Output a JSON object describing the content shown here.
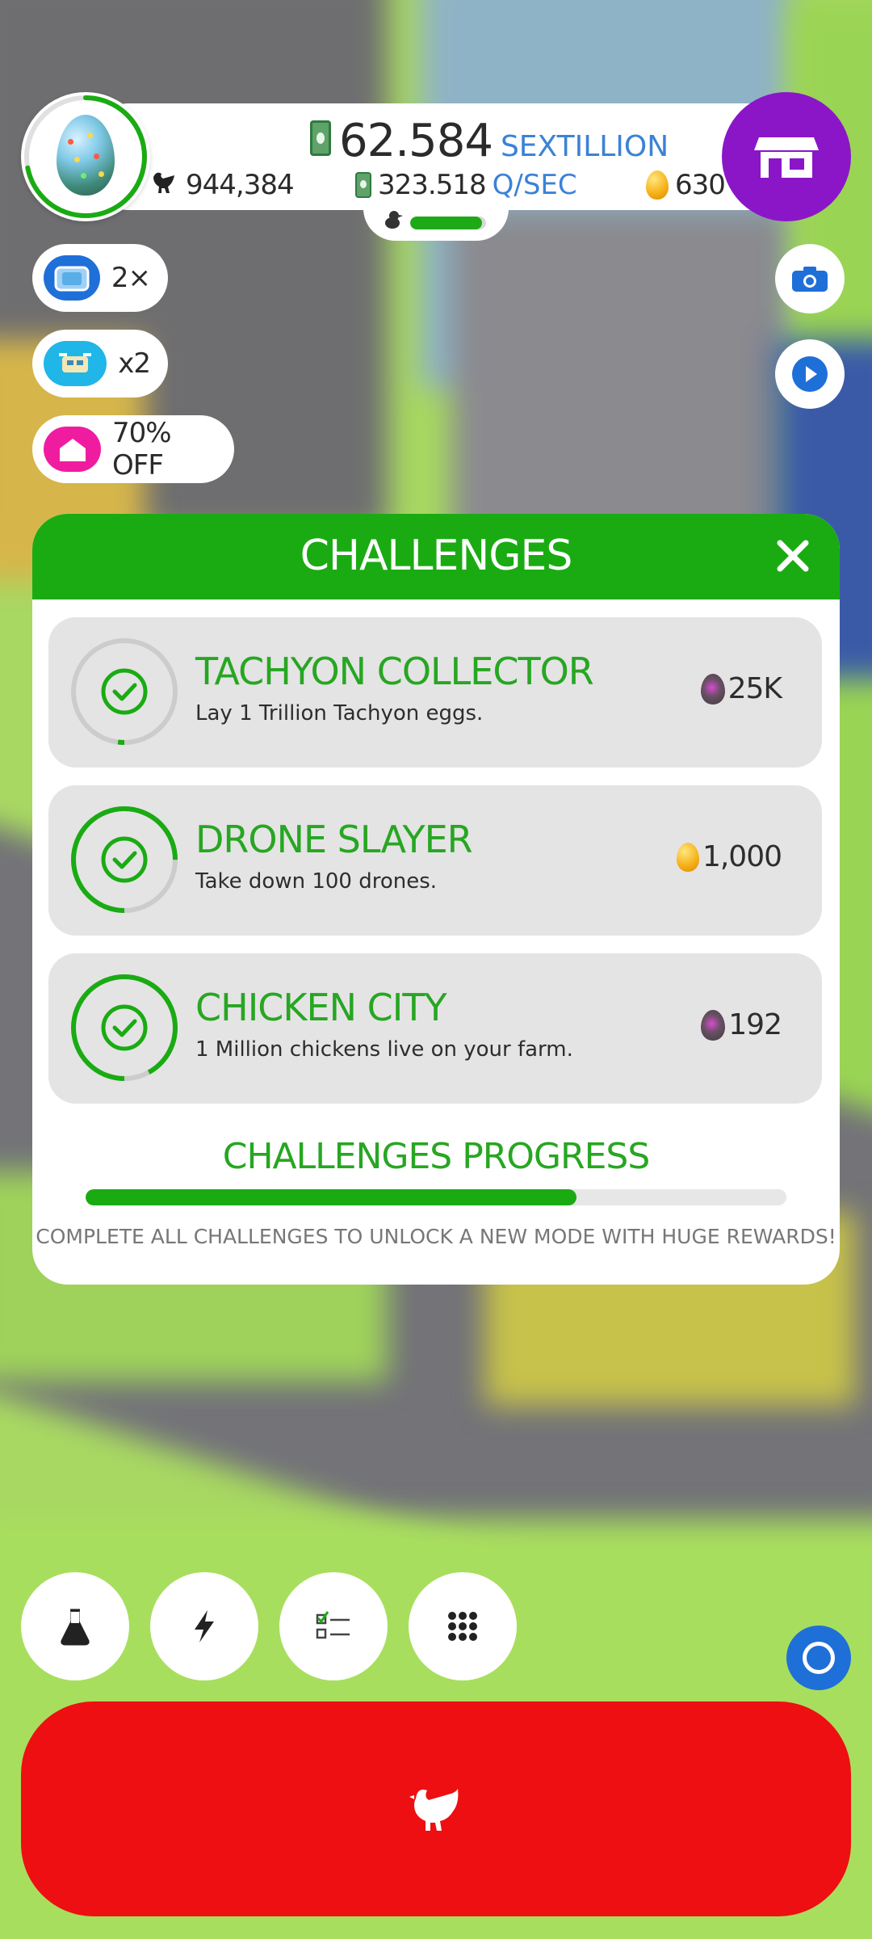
{
  "hud": {
    "cash_value": "62.584",
    "cash_unit": "SEXTILLION",
    "chicken_count": "944,384",
    "rate_value": "323.518",
    "rate_unit": "Q/SEC",
    "golden_eggs": "630",
    "hab_capacity_fill": 0.95
  },
  "boosts": [
    {
      "label": "2×",
      "icon": "tv-icon",
      "color": "#1f6fd8"
    },
    {
      "label": "x2",
      "icon": "drone-icon",
      "color": "#21b6e8"
    },
    {
      "label": "70% OFF",
      "icon": "shop-house-icon",
      "color": "#f01ca0"
    }
  ],
  "challenges_modal": {
    "title": "CHALLENGES",
    "items": [
      {
        "name": "TACHYON COLLECTOR",
        "description": "Lay 1 Trillion Tachyon eggs.",
        "reward": "25K",
        "reward_icon": "dark-egg-icon",
        "progress": 0.02
      },
      {
        "name": "DRONE SLAYER",
        "description": "Take down 100 drones.",
        "reward": "1,000",
        "reward_icon": "golden-egg-icon",
        "progress": 0.75
      },
      {
        "name": "CHICKEN CITY",
        "description": "1 Million chickens live on your farm.",
        "reward": "192",
        "reward_icon": "dark-egg-icon",
        "progress": 0.92
      }
    ],
    "progress_title": "CHALLENGES PROGRESS",
    "progress_fraction": 0.7,
    "progress_note": "COMPLETE ALL CHALLENGES TO UNLOCK A NEW MODE WITH HUGE REWARDS!"
  },
  "bottom_buttons": [
    "research-flask-icon",
    "boost-lightning-icon",
    "checklist-icon",
    "menu-grid-icon"
  ],
  "colors": {
    "accent_green": "#1aab13",
    "title_green": "#27a622",
    "shop_purple": "#8a16c8",
    "lay_red": "#ee0f12",
    "link_blue": "#3b82d6"
  }
}
